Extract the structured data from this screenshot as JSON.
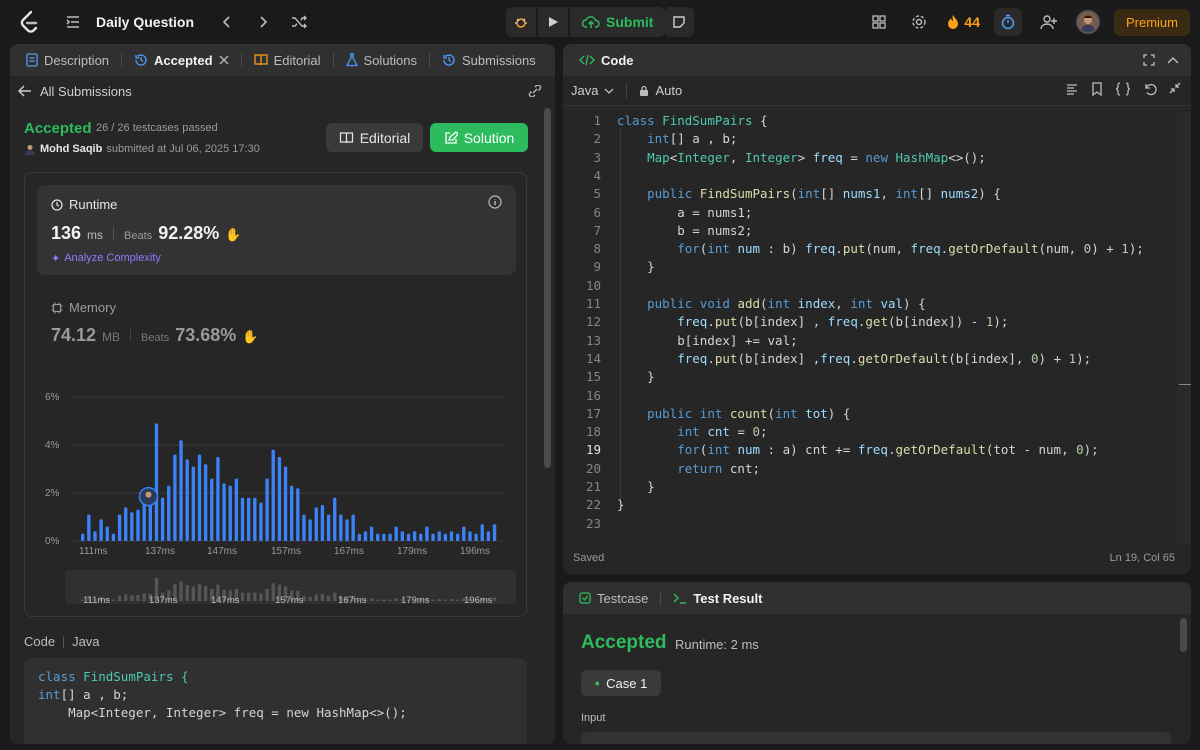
{
  "topbar": {
    "title": "Daily Question",
    "submit_label": "Submit",
    "streak_count": "44",
    "premium_label": "Premium"
  },
  "left_panel": {
    "tabs": [
      {
        "label": "Description",
        "icon": "description-icon"
      },
      {
        "label": "Accepted",
        "icon": "history-icon"
      },
      {
        "label": "Editorial",
        "icon": "book-icon"
      },
      {
        "label": "Solutions",
        "icon": "flask-icon"
      },
      {
        "label": "Submissions",
        "icon": "history-icon"
      }
    ],
    "back_label": "All Submissions",
    "status": "Accepted",
    "testcases": "26 / 26 testcases passed",
    "user": "Mohd Saqib",
    "submitted_at": "submitted at Jul 06, 2025 17:30",
    "editorial_button": "Editorial",
    "solution_button": "Solution",
    "runtime": {
      "label": "Runtime",
      "value": "136",
      "unit": "ms",
      "beats_label": "Beats",
      "beats": "92.28%",
      "analyze": "Analyze Complexity"
    },
    "memory": {
      "label": "Memory",
      "value": "74.12",
      "unit": "MB",
      "beats_label": "Beats",
      "beats": "73.68%"
    },
    "code_label": "Code",
    "code_lang": "Java",
    "code_preview": [
      "class FindSumPairs {",
      "    int[] a , b;",
      "    Map<Integer, Integer> freq = new HashMap<>();"
    ]
  },
  "chart_data": {
    "type": "bar",
    "yticks": [
      "6%",
      "4%",
      "2%",
      "0%"
    ],
    "ylim": [
      0,
      6
    ],
    "xticks": [
      "111ms",
      "137ms",
      "147ms",
      "157ms",
      "167ms",
      "179ms",
      "196ms"
    ],
    "values": [
      0.3,
      1.1,
      0.4,
      0.9,
      0.6,
      0.3,
      1.1,
      1.4,
      1.2,
      1.3,
      1.6,
      1.5,
      4.9,
      1.8,
      2.3,
      3.6,
      4.2,
      3.4,
      3.1,
      3.6,
      3.2,
      2.6,
      3.5,
      2.4,
      2.3,
      2.6,
      1.8,
      1.8,
      1.8,
      1.6,
      2.6,
      3.8,
      3.5,
      3.1,
      2.3,
      2.2,
      1.1,
      0.9,
      1.4,
      1.5,
      1.1,
      1.8,
      1.1,
      0.9,
      1.1,
      0.3,
      0.4,
      0.6,
      0.3,
      0.3,
      0.3,
      0.6,
      0.4,
      0.3,
      0.4,
      0.3,
      0.6,
      0.3,
      0.4,
      0.3,
      0.4,
      0.3,
      0.6,
      0.4,
      0.3,
      0.7,
      0.4,
      0.7
    ],
    "highlight_index": 12,
    "bar_color": "#3b82f6"
  },
  "editor": {
    "tab_label": "Code",
    "language": "Java",
    "mode": "Auto",
    "status": "Saved",
    "cursor": "Ln 19, Col 65",
    "current_line": 19
  },
  "result": {
    "tab_testcase": "Testcase",
    "tab_result": "Test Result",
    "status": "Accepted",
    "runtime": "Runtime: 2 ms",
    "case_label": "Case 1",
    "input_label": "Input"
  },
  "colors": {
    "accent_green": "#2cbb5d",
    "streak": "#ffa116",
    "bar": "#3b82f6"
  }
}
